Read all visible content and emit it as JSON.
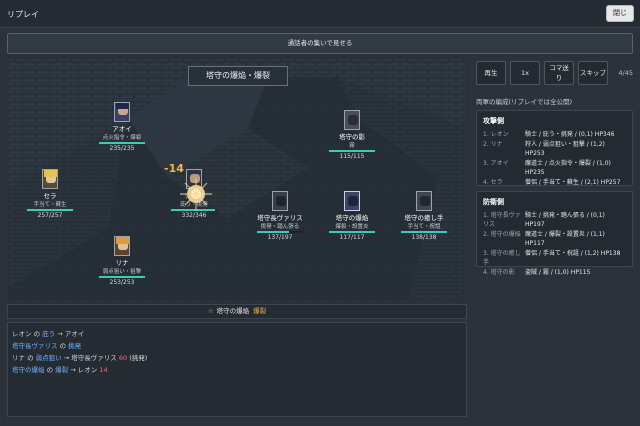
{
  "window": {
    "title": "リプレイ",
    "close_label": "閉じ"
  },
  "share_button": "通話者の集いで見せる",
  "stage": {
    "skill_banner": "塔守の爆焔・爆裂",
    "damage_popup": "-14",
    "units": [
      {
        "id": "aoi",
        "name": "アオイ",
        "job": "点火指令・爆裂",
        "hp": "235/235",
        "hp_ratio": 1.0
      },
      {
        "id": "sera",
        "name": "セラ",
        "job": "手当て・蘇生",
        "hp": "257/257",
        "hp_ratio": 1.0
      },
      {
        "id": "leon",
        "name": "レオン",
        "job": "庇う・挑発",
        "hp": "332/346",
        "hp_ratio": 0.96
      },
      {
        "id": "rina",
        "name": "リナ",
        "job": "弱点狙い・狙撃",
        "hp": "253/253",
        "hp_ratio": 1.0
      },
      {
        "id": "kage",
        "name": "塔守の影",
        "job": "霧",
        "hp": "115/115",
        "hp_ratio": 1.0
      },
      {
        "id": "varis",
        "name": "塔守長ヴァリス",
        "job": "挑発・踏ん張る",
        "hp": "137/197",
        "hp_ratio": 0.7
      },
      {
        "id": "bakuen",
        "name": "塔守の爆焔",
        "job": "爆裂・設置炎",
        "hp": "117/117",
        "hp_ratio": 1.0
      },
      {
        "id": "iyashi",
        "name": "塔守の癒し手",
        "job": "手当て・祝詛",
        "hp": "138/138",
        "hp_ratio": 1.0
      }
    ]
  },
  "controls": {
    "play": "再生",
    "speed": "1x",
    "step_line1": "コマ送",
    "step_line2": "り",
    "skip": "スキップ",
    "counter": "4/45"
  },
  "panel_note": "両軍の編成(リプレイでは全公開)",
  "attackers": {
    "heading": "攻撃側",
    "rows": [
      {
        "who": "1. レオン",
        "what": "騎士 / 庇う・挑発 / (0,1) HP346"
      },
      {
        "who": "2. リナ",
        "what": "狩人 / 弱点狙い・狙撃 / (1,2) HP253"
      },
      {
        "who": "3. アオイ",
        "what": "魔道士 / 点火指令・爆裂 / (1,0) HP235"
      },
      {
        "who": "4. セラ",
        "what": "僧侶 / 手当て・蘇生 / (2,1) HP257"
      }
    ]
  },
  "defenders": {
    "heading": "防衛側",
    "rows": [
      {
        "who": "1. 塔守長ヴァリス",
        "what": "騎士 / 挑発・踏ん張る / (0,1) HP197"
      },
      {
        "who": "2. 塔守の爆焔",
        "what": "魔道士 / 爆裂・設置炎 / (1,1) HP117"
      },
      {
        "who": "3. 塔守の癒し手",
        "what": "僧侶 / 手当て・祝詛 / (1,2) HP138"
      },
      {
        "who": "4. 塔守の影",
        "what": "盗賊 / 霧 / (1,0) HP115"
      }
    ]
  },
  "current_skill": {
    "actor": "塔守の爆焔",
    "skill": "爆裂",
    "star": "☆"
  },
  "log": [
    {
      "actor": "レオン",
      "link1": "の",
      "action": "庇う",
      "arrow": "→",
      "target": "アオイ",
      "value": "",
      "tail": ""
    },
    {
      "actor": "塔守長ヴァリス",
      "link1": "の",
      "action": "挑発",
      "arrow": "",
      "target": "",
      "value": "",
      "tail": ""
    },
    {
      "actor": "リナ",
      "link1": "の",
      "action": "弱点狙い",
      "arrow": "→",
      "target": "塔守長ヴァリス",
      "value": "60",
      "tail": "(挑発)"
    },
    {
      "actor": "塔守の爆焔",
      "link1": "の",
      "action": "爆裂",
      "arrow": "→",
      "target": "レオン",
      "value": "14",
      "tail": ""
    }
  ],
  "colors": {
    "accent_hp": "#3fc9b7",
    "damage": "#f3b646",
    "log_value": "#ff6b6b",
    "log_link": "#6fb3ff"
  }
}
